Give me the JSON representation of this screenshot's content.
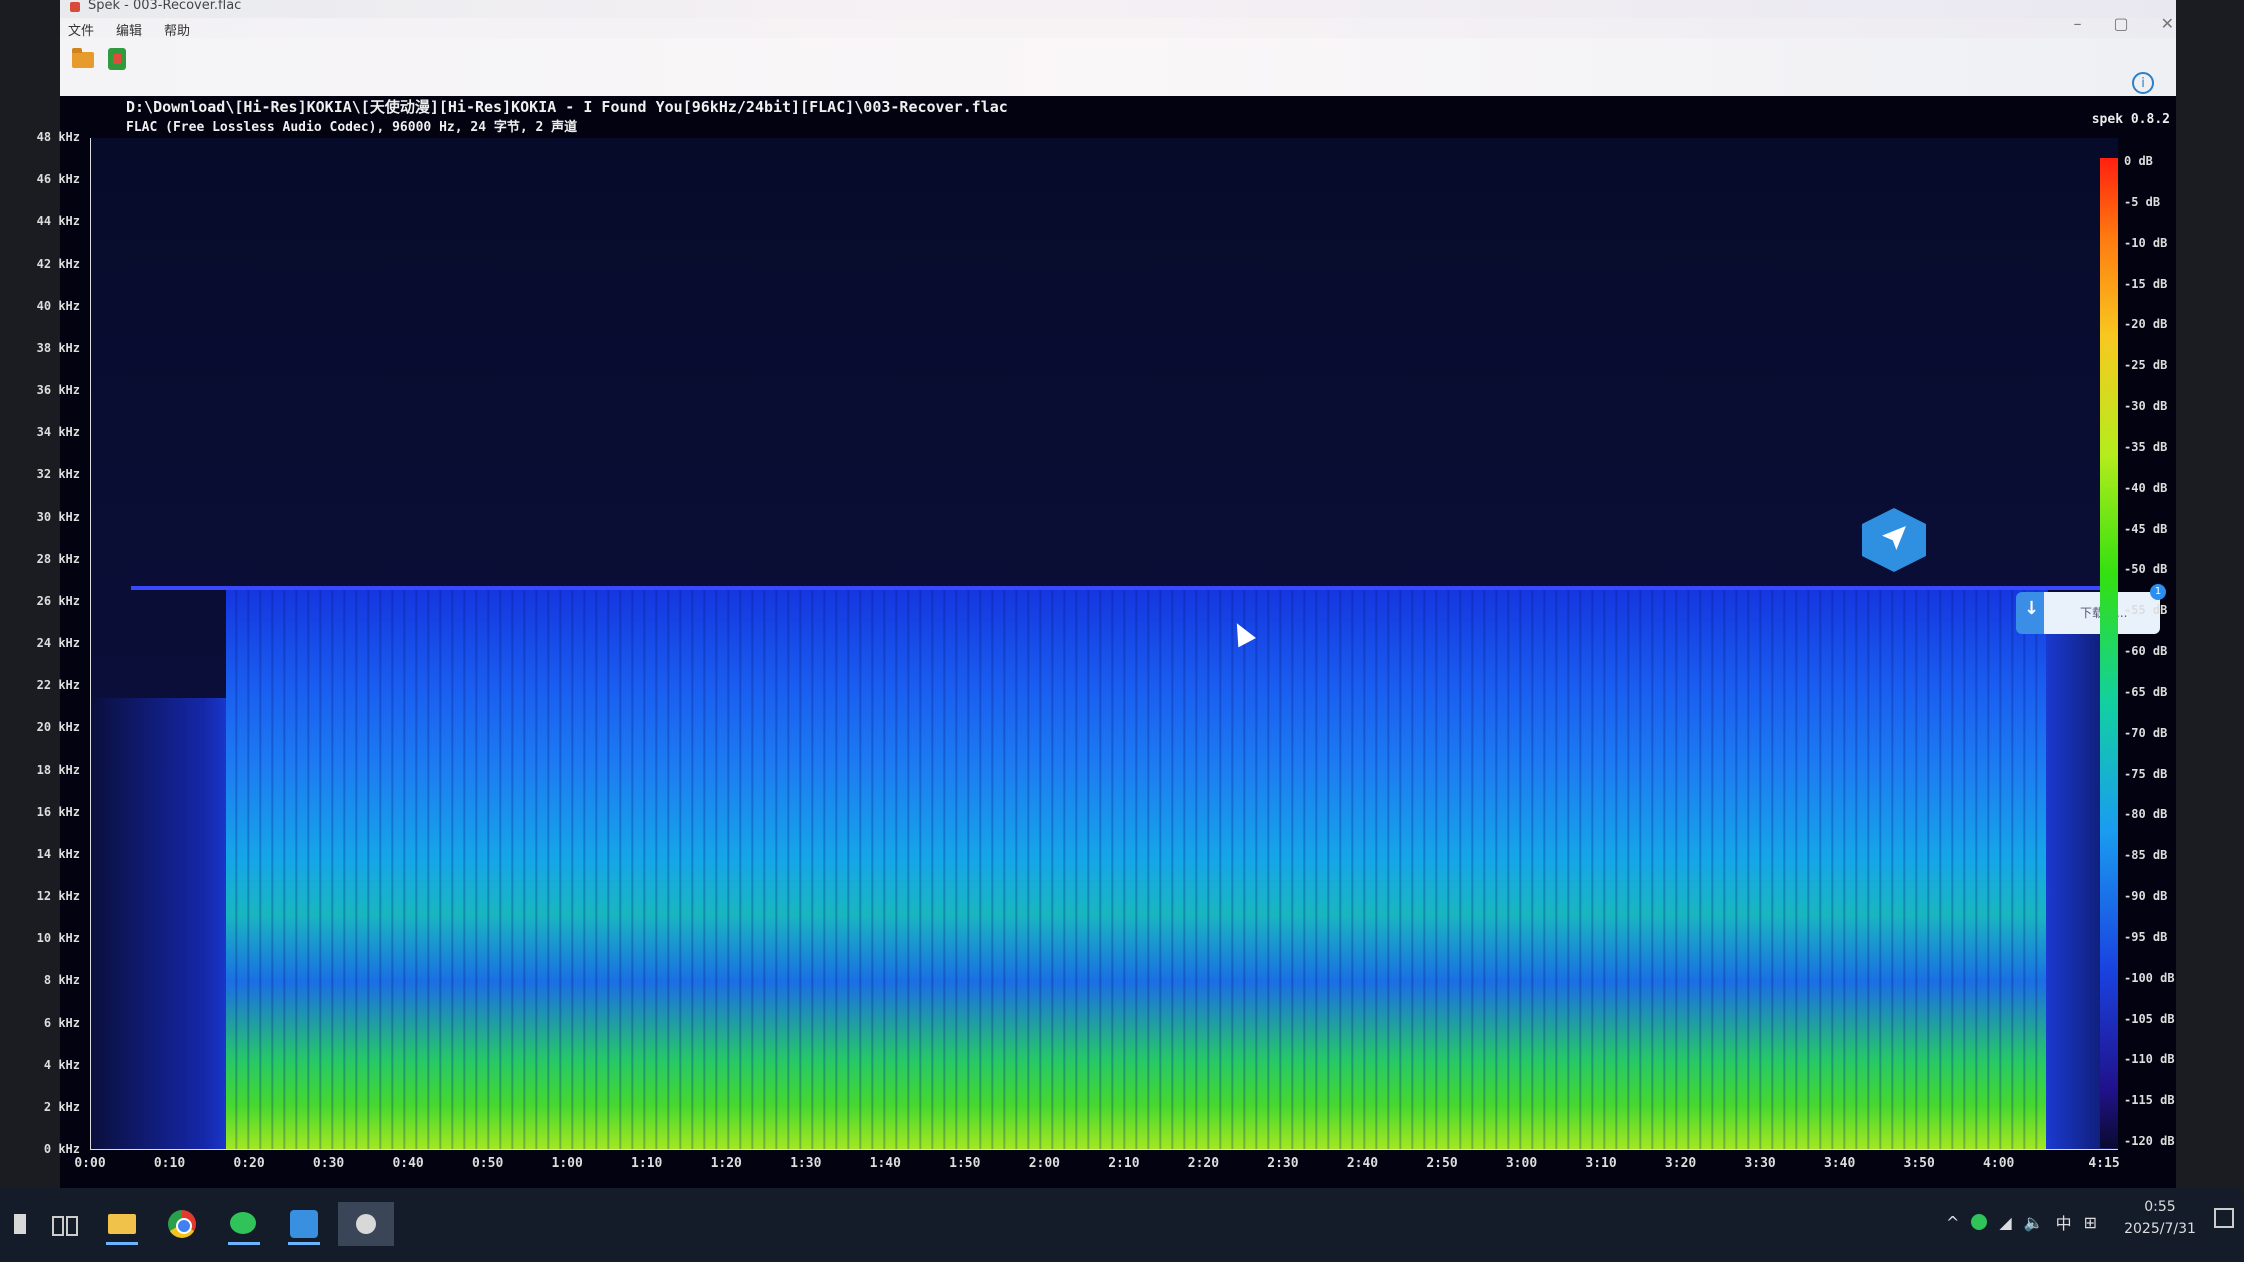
{
  "window": {
    "title": "Spek - 003-Recover.flac",
    "menu": [
      "文件",
      "编辑",
      "帮助"
    ],
    "controls": [
      "–",
      "▢",
      "✕"
    ],
    "help_icon": "i"
  },
  "file": {
    "path": "D:\\Download\\[Hi-Res]KOKIA\\[天使动漫][Hi-Res]KOKIA - I Found You[96kHz/24bit][FLAC]\\003-Recover.flac",
    "info": "FLAC (Free Lossless Audio Codec), 96000 Hz, 24 字节, 2 声道",
    "version": "spek 0.8.2"
  },
  "frequency_axis": [
    "48 kHz",
    "46 kHz",
    "44 kHz",
    "42 kHz",
    "40 kHz",
    "38 kHz",
    "36 kHz",
    "34 kHz",
    "32 kHz",
    "30 kHz",
    "28 kHz",
    "26 kHz",
    "24 kHz",
    "22 kHz",
    "20 kHz",
    "18 kHz",
    "16 kHz",
    "14 kHz",
    "12 kHz",
    "10 kHz",
    "8 kHz",
    "6 kHz",
    "4 kHz",
    "2 kHz",
    "0 kHz"
  ],
  "time_axis": [
    "0:00",
    "0:10",
    "0:20",
    "0:30",
    "0:40",
    "0:50",
    "1:00",
    "1:10",
    "1:20",
    "1:30",
    "1:40",
    "1:50",
    "2:00",
    "2:10",
    "2:20",
    "2:30",
    "2:40",
    "2:50",
    "3:00",
    "3:10",
    "3:20",
    "3:30",
    "3:40",
    "3:50",
    "4:00",
    "4:15"
  ],
  "db_axis": [
    "0 dB",
    "-5 dB",
    "-10 dB",
    "-15 dB",
    "-20 dB",
    "-25 dB",
    "-30 dB",
    "-35 dB",
    "-40 dB",
    "-45 dB",
    "-50 dB",
    "-55 dB",
    "-60 dB",
    "-65 dB",
    "-70 dB",
    "-75 dB",
    "-80 dB",
    "-85 dB",
    "-90 dB",
    "-95 dB",
    "-100 dB",
    "-105 dB",
    "-110 dB",
    "-115 dB",
    "-120 dB"
  ],
  "overlay": {
    "download_label": "下载中...",
    "download_badge": "1"
  },
  "taskbar": {
    "tray": [
      "^",
      "中"
    ],
    "time": "0:55",
    "date": "2025/7/31"
  },
  "colors": {
    "spectrogram_background": "#020210",
    "cutoff_line": "#3a48ff",
    "accent": "#3a8ee6"
  }
}
